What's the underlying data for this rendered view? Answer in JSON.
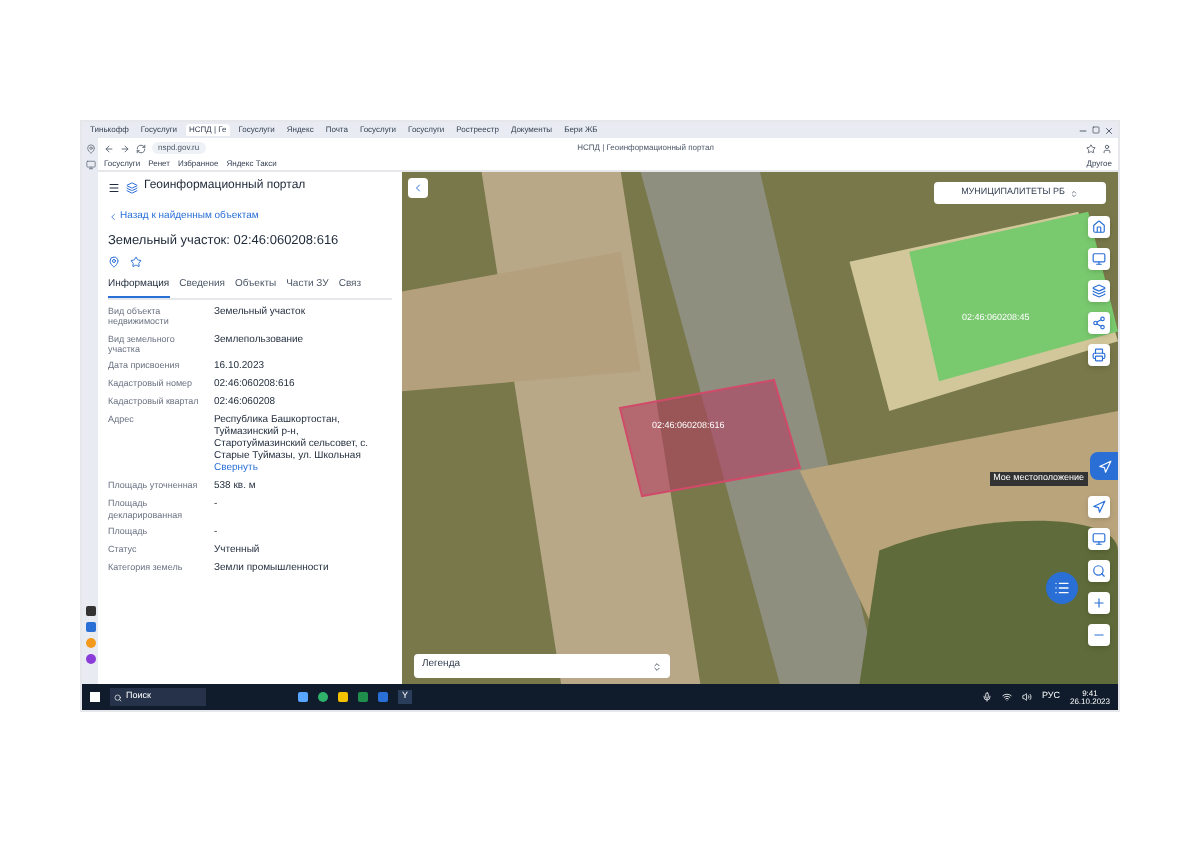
{
  "browser": {
    "tabs": [
      {
        "title": "Тинькофф",
        "selected": false
      },
      {
        "title": "Госуслуги",
        "selected": false
      },
      {
        "title": "НСПД | Ге",
        "selected": true
      },
      {
        "title": "Госуслуги",
        "selected": false
      },
      {
        "title": "Яндекс",
        "selected": false
      },
      {
        "title": "Почта",
        "selected": false
      },
      {
        "title": "Госуслуги",
        "selected": false
      },
      {
        "title": "Госуслуги",
        "selected": false
      },
      {
        "title": "Ростреестр",
        "selected": false
      },
      {
        "title": "Документы",
        "selected": false
      },
      {
        "title": "Бери ЖБ",
        "selected": false
      }
    ],
    "url": "nspd.gov.ru",
    "page_title": "НСПД | Геоинформационный портал",
    "bookmarks": [
      "Госуслуги",
      "Ренет",
      "Избранное",
      "Яндекс Такси"
    ],
    "other_bookmarks": "Другое"
  },
  "panel": {
    "portal_title": "Геоинформационный портал",
    "back_link": "Назад к найденным объектам",
    "heading": "Земельный участок: 02:46:060208:616",
    "tabs": [
      {
        "label": "Информация",
        "selected": true
      },
      {
        "label": "Сведения",
        "selected": false
      },
      {
        "label": "Объекты",
        "selected": false
      },
      {
        "label": "Части ЗУ",
        "selected": false
      },
      {
        "label": "Связ",
        "selected": false
      }
    ],
    "fields": [
      {
        "label": "Вид объекта недвижимости",
        "value": "Земельный участок"
      },
      {
        "label": "Вид земельного участка",
        "value": "Землепользование"
      },
      {
        "label": "Дата присвоения",
        "value": "16.10.2023"
      },
      {
        "label": "Кадастровый номер",
        "value": "02:46:060208:616"
      },
      {
        "label": "Кадастровый квартал",
        "value": "02:46:060208"
      },
      {
        "label": "Адрес",
        "value": "Республика Башкортостан, Туймазинский р-н, Старотуймазинский сельсовет, с. Старые Туймазы, ул. Школьная",
        "link": "Свернуть"
      },
      {
        "label": "Площадь уточненная",
        "value": "538 кв. м"
      },
      {
        "label": "Площадь декларированная",
        "value": "-"
      },
      {
        "label": "Площадь",
        "value": "-"
      },
      {
        "label": "Статус",
        "value": "Учтенный"
      },
      {
        "label": "Категория земель",
        "value": "Земли промышленности"
      }
    ]
  },
  "map": {
    "layer_select": "МУНИЦИПАЛИТЕТЫ РБ",
    "parcel_label": "02:46:060208:616",
    "building_label": "02:46:060208:45",
    "tooltip": "Мое местоположение",
    "legend": "Легенда"
  },
  "taskbar": {
    "search": "Поиск",
    "app_label": "Y",
    "lang": "РУС",
    "time": "9:41",
    "date": "26.10.2023"
  }
}
